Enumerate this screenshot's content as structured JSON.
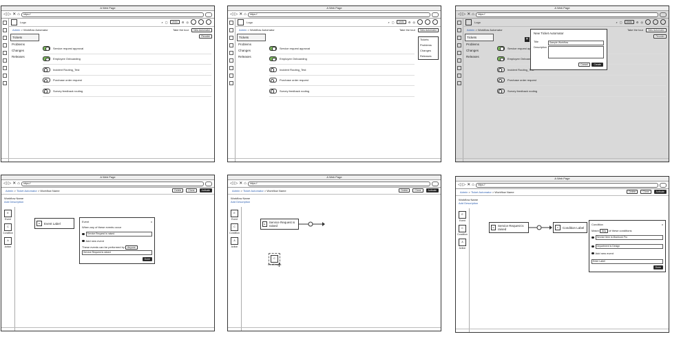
{
  "browser": {
    "window_title": "A Web Page",
    "url": "https://"
  },
  "app": {
    "logo": "Logo",
    "undo_btn": "Undo",
    "take_tour": "Take the tour",
    "new_automator": "New Automator",
    "reorder": "Reorder",
    "crumb_admin": "Admin",
    "crumb_sep": ">",
    "crumb_page": "Workflow Automator",
    "tabs": [
      "Tickets",
      "Problems",
      "Changes",
      "Releases"
    ],
    "workflows": [
      {
        "name": "Service request approval",
        "on": true
      },
      {
        "name": "Employee Onboarding",
        "on": true
      },
      {
        "name": "Incident Routing_Test",
        "on": false
      },
      {
        "name": "Purchase order request",
        "on": false
      },
      {
        "name": "Survey feedback routing",
        "on": false
      }
    ]
  },
  "dropdown_items": [
    "Tickets",
    "Problems",
    "Changes",
    "Releases"
  ],
  "modal": {
    "title": "New Ticket Automator",
    "title_label": "Title",
    "title_value": "Sample Workflow",
    "desc_label": "Description",
    "cancel": "Cancel",
    "create": "Create"
  },
  "editor": {
    "crumb_admin": "Admin",
    "crumb_ticket": "Ticket Automator",
    "crumb_name": "Workflow Name",
    "btn_delete": "Delete",
    "btn_clone": "Clone",
    "btn_activate": "Activate",
    "workflow_name": "Workflow Name",
    "add_description": "Add Description",
    "palette": [
      {
        "letter": "E",
        "label": "Event"
      },
      {
        "letter": "C",
        "label": "Condition"
      },
      {
        "letter": "A",
        "label": "Action"
      }
    ]
  },
  "event_panel": {
    "node_label": "Event Label",
    "title": "Event",
    "close": "x",
    "when_text": "When any of these events occur",
    "event_value": "Service Request is raised",
    "add_new_event": "Add new event",
    "performed_by": "These events can be performed by",
    "performed_select": "Anyone",
    "name_value": "Service Request is raised",
    "done": "Done"
  },
  "canvas2": {
    "node_text": "Service Request is raised",
    "dragging_label": "Condition"
  },
  "condition_panel": {
    "event_node": "Service Request is raised",
    "cond_node": "Condition Label",
    "title": "Condition",
    "close": "x",
    "match": "Match",
    "match_select": "Any",
    "match_suffix": "of these conditions",
    "cond1": "Service Item is Macbook Pro",
    "cond2": "Department is Design",
    "add_new_event": "Add new event",
    "label_placeholder": "Enter Label",
    "done": "Done"
  }
}
